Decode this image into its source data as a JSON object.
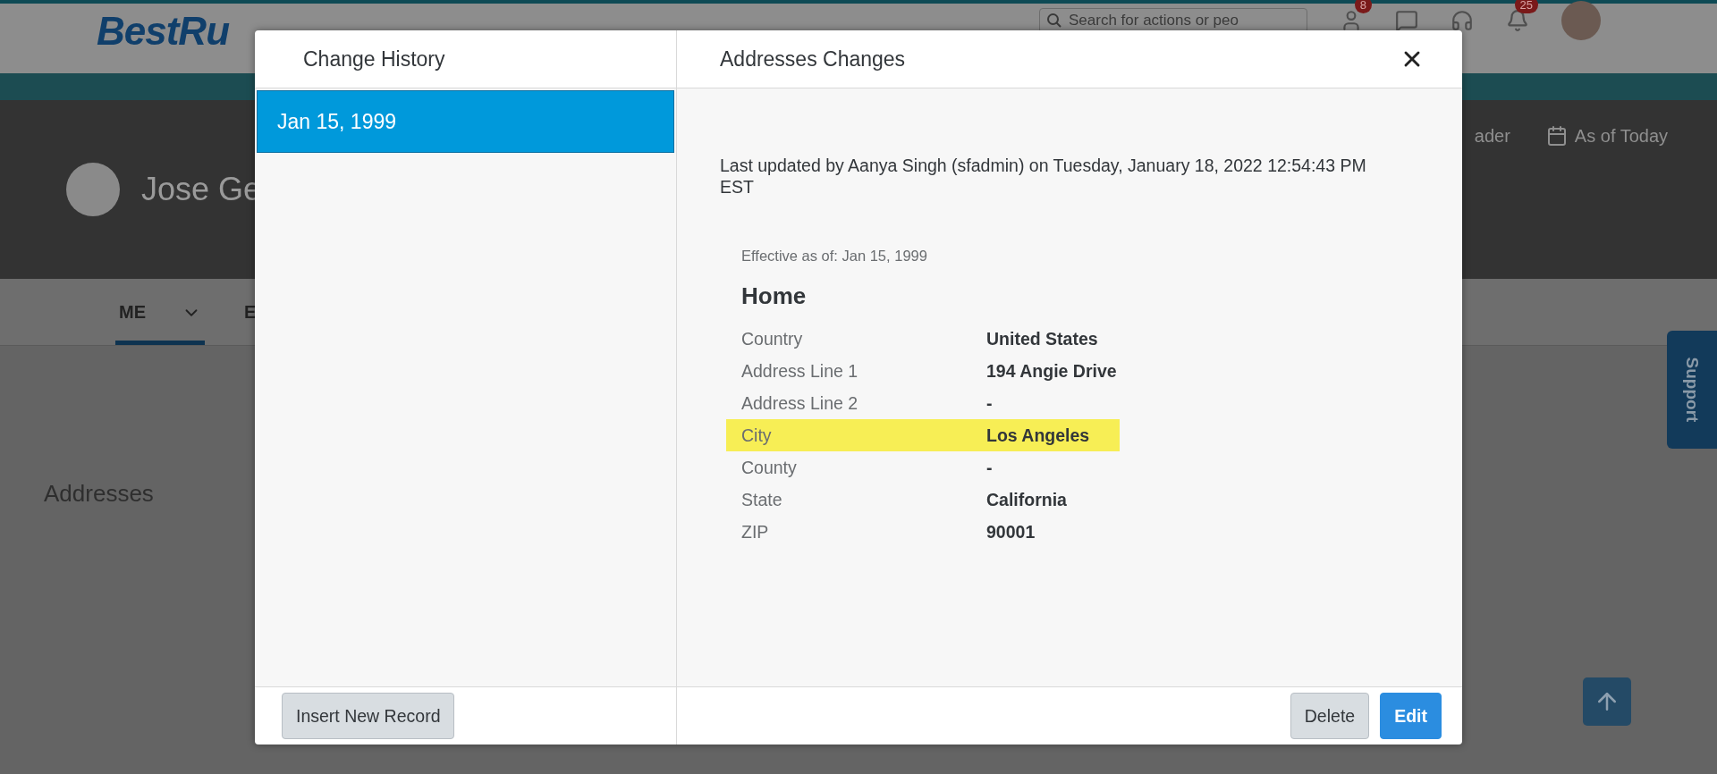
{
  "header": {
    "logo": "BestRu",
    "search": {
      "placeholder": "Search for actions or peo"
    },
    "badges": [
      "8",
      "25"
    ]
  },
  "banner": {
    "name": "Jose Ge",
    "action": "ader",
    "date_label": "As of Today"
  },
  "tabs": [
    {
      "label": "ME",
      "selected": true
    },
    {
      "label": "E",
      "selected": false
    }
  ],
  "section_title": "Addresses",
  "support": "Support",
  "dialog": {
    "history_title": "Change History",
    "history": [
      {
        "date": "Jan 15, 1999",
        "selected": true
      }
    ],
    "title": "Addresses Changes",
    "last_updated": "Last updated by Aanya Singh (sfadmin) on Tuesday, January 18, 2022 12:54:43 PM EST",
    "effective": "Effective as of: Jan 15, 1999",
    "address_type": "Home",
    "fields": [
      {
        "label": "Country",
        "value": "United States",
        "highlighted": false
      },
      {
        "label": "Address Line 1",
        "value": "194 Angie Drive",
        "highlighted": false
      },
      {
        "label": "Address Line 2",
        "value": "-",
        "highlighted": false
      },
      {
        "label": "City",
        "value": "Los Angeles",
        "highlighted": true
      },
      {
        "label": "County",
        "value": "-",
        "highlighted": false
      },
      {
        "label": "State",
        "value": "California",
        "highlighted": false
      },
      {
        "label": "ZIP",
        "value": "90001",
        "highlighted": false
      }
    ],
    "insert_button": "Insert New Record",
    "buttons": [
      {
        "label": "Delete",
        "kind": "secondary"
      },
      {
        "label": "Edit",
        "kind": "primary"
      }
    ]
  }
}
